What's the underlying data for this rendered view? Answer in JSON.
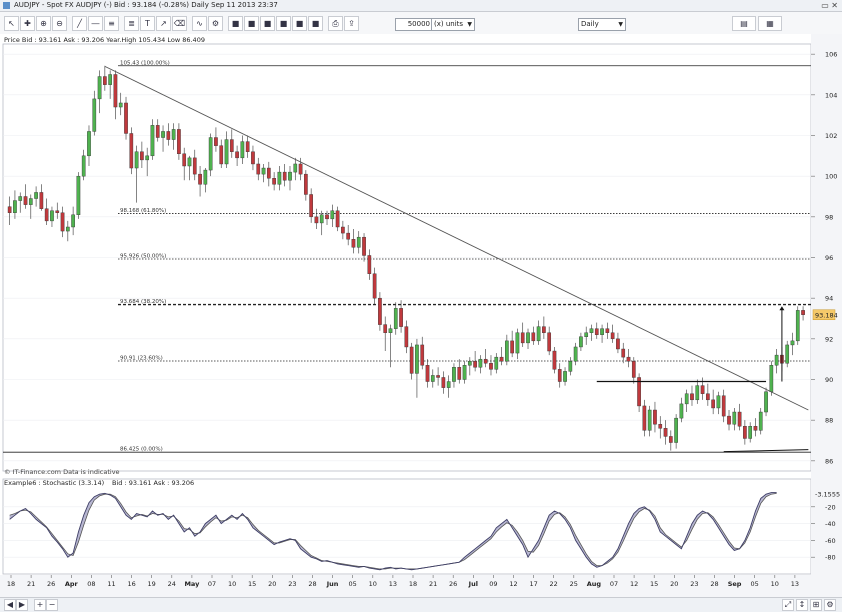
{
  "window": {
    "title": "AUDJPY - Spot FX AUDJPY (-)   Bid : 93.184 (-0.28%)   Daily   Sep 11 2013 23:37"
  },
  "toolbar": {
    "units_value": "50000",
    "units_label": "(x) units",
    "period_label": "Daily"
  },
  "price_panel": {
    "header": "Price   Bid : 93.161 Ask : 93.206  Year.High 105.434 Low 86.409",
    "last_price_label": "93.184",
    "y_ticks": [
      "106",
      "104",
      "102",
      "100",
      "98",
      "96",
      "94",
      "92",
      "90",
      "88",
      "86"
    ],
    "watermark": "© IT-Finance.com  Data is indicative"
  },
  "stoch_panel": {
    "header": "Example6 : Stochastic (3.3.14)",
    "overlay": "Bid : 93.161 Ask : 93.206",
    "value_label": "-3.1555",
    "y_ticks": [
      "-20",
      "-40",
      "-60",
      "-80"
    ]
  },
  "x_axis": {
    "ticks": [
      {
        "label": "18",
        "bold": false
      },
      {
        "label": "21",
        "bold": false
      },
      {
        "label": "26",
        "bold": false
      },
      {
        "label": "Apr",
        "bold": true
      },
      {
        "label": "08",
        "bold": false
      },
      {
        "label": "11",
        "bold": false
      },
      {
        "label": "16",
        "bold": false
      },
      {
        "label": "19",
        "bold": false
      },
      {
        "label": "24",
        "bold": false
      },
      {
        "label": "May",
        "bold": true
      },
      {
        "label": "07",
        "bold": false
      },
      {
        "label": "10",
        "bold": false
      },
      {
        "label": "15",
        "bold": false
      },
      {
        "label": "20",
        "bold": false
      },
      {
        "label": "23",
        "bold": false
      },
      {
        "label": "28",
        "bold": false
      },
      {
        "label": "Jun",
        "bold": true
      },
      {
        "label": "05",
        "bold": false
      },
      {
        "label": "10",
        "bold": false
      },
      {
        "label": "13",
        "bold": false
      },
      {
        "label": "18",
        "bold": false
      },
      {
        "label": "21",
        "bold": false
      },
      {
        "label": "26",
        "bold": false
      },
      {
        "label": "Jul",
        "bold": true
      },
      {
        "label": "09",
        "bold": false
      },
      {
        "label": "12",
        "bold": false
      },
      {
        "label": "17",
        "bold": false
      },
      {
        "label": "22",
        "bold": false
      },
      {
        "label": "25",
        "bold": false
      },
      {
        "label": "Aug",
        "bold": true
      },
      {
        "label": "07",
        "bold": false
      },
      {
        "label": "12",
        "bold": false
      },
      {
        "label": "15",
        "bold": false
      },
      {
        "label": "20",
        "bold": false
      },
      {
        "label": "23",
        "bold": false
      },
      {
        "label": "28",
        "bold": false
      },
      {
        "label": "Sep",
        "bold": true
      },
      {
        "label": "05",
        "bold": false
      },
      {
        "label": "10",
        "bold": false
      },
      {
        "label": "13",
        "bold": false
      }
    ]
  },
  "chart_data": {
    "type": "candlestick",
    "ylim": [
      85.5,
      106.5
    ],
    "stoch_ylim": [
      -100,
      0
    ],
    "fib_levels": [
      {
        "label": "105.43 (100.00%)",
        "value": 105.43,
        "style": "solid"
      },
      {
        "label": "98.168 (61.80%)",
        "value": 98.168,
        "style": "dotted"
      },
      {
        "label": "95.926 (50.00%)",
        "value": 95.926,
        "style": "dotted"
      },
      {
        "label": "93.684 (38.20%)",
        "value": 93.684,
        "style": "dashed"
      },
      {
        "label": "90.91 (23.60%)",
        "value": 90.91,
        "style": "dotted"
      },
      {
        "label": "86.425 (0.00%)",
        "value": 86.425,
        "style": "solid"
      }
    ],
    "ohlc": [
      [
        98.5,
        99.0,
        97.6,
        98.2
      ],
      [
        98.2,
        99.3,
        97.9,
        98.8
      ],
      [
        98.8,
        99.2,
        98.2,
        99.0
      ],
      [
        99.0,
        99.6,
        98.4,
        98.6
      ],
      [
        98.6,
        99.1,
        97.9,
        98.9
      ],
      [
        98.9,
        99.5,
        98.5,
        99.2
      ],
      [
        99.2,
        99.6,
        98.3,
        98.4
      ],
      [
        98.4,
        98.9,
        97.6,
        97.8
      ],
      [
        97.8,
        98.5,
        97.5,
        98.3
      ],
      [
        98.3,
        98.7,
        97.9,
        98.2
      ],
      [
        98.2,
        98.5,
        97.0,
        97.3
      ],
      [
        97.3,
        97.8,
        96.8,
        97.5
      ],
      [
        97.5,
        98.5,
        97.1,
        98.1
      ],
      [
        98.1,
        100.2,
        97.9,
        100.0
      ],
      [
        100.0,
        101.3,
        99.8,
        101.0
      ],
      [
        101.0,
        102.5,
        100.5,
        102.2
      ],
      [
        102.2,
        104.2,
        102.0,
        103.8
      ],
      [
        103.8,
        105.2,
        103.1,
        104.9
      ],
      [
        104.9,
        105.43,
        104.2,
        104.5
      ],
      [
        104.5,
        105.2,
        103.8,
        105.0
      ],
      [
        105.0,
        105.2,
        102.8,
        103.4
      ],
      [
        103.4,
        104.1,
        103.0,
        103.6
      ],
      [
        103.6,
        103.9,
        101.8,
        102.1
      ],
      [
        102.1,
        102.4,
        100.1,
        100.4
      ],
      [
        100.4,
        101.5,
        98.7,
        101.2
      ],
      [
        101.2,
        101.7,
        100.4,
        100.8
      ],
      [
        100.8,
        101.4,
        100.0,
        101.0
      ],
      [
        101.0,
        102.8,
        100.8,
        102.5
      ],
      [
        102.5,
        102.8,
        101.7,
        101.9
      ],
      [
        101.9,
        102.5,
        101.2,
        102.2
      ],
      [
        102.2,
        102.6,
        101.5,
        101.8
      ],
      [
        101.8,
        102.6,
        101.3,
        102.3
      ],
      [
        102.3,
        102.6,
        100.8,
        101.1
      ],
      [
        101.1,
        101.4,
        99.8,
        100.5
      ],
      [
        100.5,
        101.0,
        99.8,
        100.9
      ],
      [
        100.9,
        101.3,
        99.8,
        100.1
      ],
      [
        100.1,
        100.5,
        99.0,
        99.6
      ],
      [
        99.6,
        100.4,
        99.2,
        100.3
      ],
      [
        100.3,
        102.1,
        100.0,
        101.9
      ],
      [
        101.9,
        102.4,
        101.2,
        101.5
      ],
      [
        101.5,
        101.8,
        100.4,
        100.6
      ],
      [
        100.6,
        102.2,
        100.4,
        101.8
      ],
      [
        101.8,
        102.3,
        100.9,
        101.2
      ],
      [
        101.2,
        101.5,
        100.5,
        100.9
      ],
      [
        100.9,
        102.0,
        100.6,
        101.7
      ],
      [
        101.7,
        102.0,
        100.9,
        101.2
      ],
      [
        101.2,
        101.5,
        100.3,
        100.6
      ],
      [
        100.6,
        100.9,
        99.8,
        100.1
      ],
      [
        100.1,
        100.6,
        99.7,
        100.4
      ],
      [
        100.4,
        100.7,
        99.5,
        99.9
      ],
      [
        99.9,
        100.2,
        99.3,
        99.6
      ],
      [
        99.6,
        100.5,
        99.3,
        100.2
      ],
      [
        100.2,
        100.6,
        99.5,
        99.8
      ],
      [
        99.8,
        100.5,
        99.3,
        100.2
      ],
      [
        100.2,
        100.9,
        99.8,
        100.6
      ],
      [
        100.6,
        100.9,
        99.8,
        100.1
      ],
      [
        100.1,
        100.3,
        98.8,
        99.1
      ],
      [
        99.1,
        99.4,
        97.7,
        98.0
      ],
      [
        98.0,
        98.4,
        97.4,
        97.7
      ],
      [
        97.7,
        98.3,
        97.1,
        98.1
      ],
      [
        98.1,
        98.3,
        97.6,
        97.9
      ],
      [
        97.9,
        98.6,
        97.5,
        98.3
      ],
      [
        98.3,
        98.5,
        97.3,
        97.5
      ],
      [
        97.5,
        97.8,
        96.9,
        97.2
      ],
      [
        97.2,
        97.6,
        96.6,
        96.9
      ],
      [
        96.9,
        97.4,
        96.2,
        96.5
      ],
      [
        96.5,
        97.3,
        96.2,
        97.0
      ],
      [
        97.0,
        97.2,
        95.8,
        96.1
      ],
      [
        96.1,
        96.4,
        94.9,
        95.2
      ],
      [
        95.2,
        95.5,
        93.7,
        94.0
      ],
      [
        94.0,
        94.3,
        92.4,
        92.7
      ],
      [
        92.7,
        93.1,
        91.4,
        92.3
      ],
      [
        92.3,
        92.7,
        90.6,
        92.5
      ],
      [
        92.5,
        93.8,
        92.2,
        93.5
      ],
      [
        93.5,
        93.9,
        92.3,
        92.6
      ],
      [
        92.6,
        92.9,
        91.3,
        91.6
      ],
      [
        91.6,
        91.8,
        90.0,
        90.3
      ],
      [
        90.3,
        92.0,
        89.1,
        91.7
      ],
      [
        91.7,
        92.1,
        90.5,
        90.7
      ],
      [
        90.7,
        91.0,
        89.6,
        89.9
      ],
      [
        89.9,
        90.5,
        89.6,
        90.2
      ],
      [
        90.2,
        90.6,
        89.7,
        90.1
      ],
      [
        90.1,
        90.4,
        89.3,
        89.6
      ],
      [
        89.6,
        90.2,
        89.1,
        89.9
      ],
      [
        89.9,
        90.8,
        89.6,
        90.6
      ],
      [
        90.6,
        91.0,
        89.8,
        90.0
      ],
      [
        90.0,
        90.9,
        89.8,
        90.7
      ],
      [
        90.7,
        91.1,
        90.2,
        90.9
      ],
      [
        90.9,
        91.4,
        90.4,
        90.6
      ],
      [
        90.6,
        91.2,
        90.3,
        91.0
      ],
      [
        91.0,
        91.5,
        90.6,
        90.8
      ],
      [
        90.8,
        91.2,
        90.2,
        90.5
      ],
      [
        90.5,
        91.3,
        90.3,
        91.1
      ],
      [
        91.1,
        91.6,
        90.7,
        90.9
      ],
      [
        90.9,
        92.2,
        90.7,
        91.9
      ],
      [
        91.9,
        92.4,
        91.1,
        91.3
      ],
      [
        91.3,
        92.5,
        91.0,
        92.3
      ],
      [
        92.3,
        92.8,
        91.6,
        91.8
      ],
      [
        91.8,
        92.5,
        91.5,
        92.3
      ],
      [
        92.3,
        92.6,
        91.7,
        91.9
      ],
      [
        91.9,
        92.9,
        91.7,
        92.6
      ],
      [
        92.6,
        93.1,
        92.0,
        92.3
      ],
      [
        92.3,
        92.6,
        91.2,
        91.4
      ],
      [
        91.4,
        91.6,
        90.3,
        90.5
      ],
      [
        90.5,
        90.8,
        89.6,
        89.9
      ],
      [
        89.9,
        90.6,
        89.7,
        90.4
      ],
      [
        90.4,
        91.1,
        90.2,
        90.9
      ],
      [
        90.9,
        91.8,
        90.7,
        91.6
      ],
      [
        91.6,
        92.3,
        91.4,
        92.1
      ],
      [
        92.1,
        92.6,
        91.7,
        92.3
      ],
      [
        92.3,
        92.7,
        91.9,
        92.5
      ],
      [
        92.5,
        92.8,
        92.0,
        92.2
      ],
      [
        92.2,
        92.7,
        91.8,
        92.5
      ],
      [
        92.5,
        92.8,
        92.0,
        92.3
      ],
      [
        92.3,
        92.7,
        91.8,
        92.0
      ],
      [
        92.0,
        92.3,
        91.3,
        91.5
      ],
      [
        91.5,
        91.8,
        90.8,
        91.1
      ],
      [
        91.1,
        91.5,
        90.6,
        90.9
      ],
      [
        90.9,
        91.1,
        89.8,
        90.1
      ],
      [
        90.1,
        90.3,
        88.4,
        88.7
      ],
      [
        88.7,
        89.0,
        87.2,
        87.5
      ],
      [
        87.5,
        88.7,
        87.2,
        88.5
      ],
      [
        88.5,
        88.9,
        87.4,
        87.8
      ],
      [
        87.8,
        88.2,
        87.1,
        87.6
      ],
      [
        87.6,
        88.0,
        86.8,
        87.2
      ],
      [
        87.2,
        87.5,
        86.5,
        86.9
      ],
      [
        86.9,
        88.3,
        86.6,
        88.1
      ],
      [
        88.1,
        89.1,
        87.9,
        88.8
      ],
      [
        88.8,
        89.5,
        88.4,
        89.3
      ],
      [
        89.3,
        89.7,
        88.7,
        89.0
      ],
      [
        89.0,
        90.0,
        88.8,
        89.7
      ],
      [
        89.7,
        90.1,
        89.0,
        89.3
      ],
      [
        89.3,
        89.8,
        88.7,
        89.0
      ],
      [
        89.0,
        89.5,
        88.3,
        88.6
      ],
      [
        88.6,
        89.4,
        88.3,
        89.2
      ],
      [
        89.2,
        89.5,
        87.9,
        88.2
      ],
      [
        88.2,
        88.5,
        87.5,
        87.8
      ],
      [
        87.8,
        88.6,
        87.5,
        88.4
      ],
      [
        88.4,
        88.8,
        87.5,
        87.7
      ],
      [
        87.7,
        88.0,
        86.8,
        87.1
      ],
      [
        87.1,
        87.9,
        86.9,
        87.7
      ],
      [
        87.7,
        88.1,
        87.2,
        87.5
      ],
      [
        87.5,
        88.6,
        87.3,
        88.4
      ],
      [
        88.4,
        89.6,
        88.2,
        89.4
      ],
      [
        89.4,
        90.9,
        89.2,
        90.7
      ],
      [
        90.7,
        91.5,
        90.3,
        91.2
      ],
      [
        91.2,
        91.6,
        90.4,
        90.8
      ],
      [
        90.8,
        91.9,
        90.6,
        91.7
      ],
      [
        91.7,
        92.3,
        91.2,
        91.9
      ],
      [
        91.9,
        93.6,
        91.7,
        93.4
      ],
      [
        93.4,
        93.6,
        92.9,
        93.184
      ]
    ],
    "stochastic": [
      -35,
      -30,
      -25,
      -22,
      -28,
      -35,
      -40,
      -45,
      -55,
      -62,
      -70,
      -80,
      -75,
      -50,
      -30,
      -15,
      -8,
      -5,
      -4,
      -6,
      -10,
      -20,
      -30,
      -35,
      -28,
      -30,
      -32,
      -25,
      -30,
      -28,
      -35,
      -30,
      -40,
      -50,
      -45,
      -55,
      -50,
      -40,
      -35,
      -30,
      -40,
      -35,
      -30,
      -35,
      -28,
      -35,
      -45,
      -50,
      -55,
      -60,
      -65,
      -62,
      -60,
      -58,
      -60,
      -70,
      -75,
      -80,
      -82,
      -85,
      -84,
      -86,
      -88,
      -89,
      -90,
      -91,
      -92,
      -91,
      -93,
      -94,
      -95,
      -93,
      -92,
      -94,
      -93,
      -94,
      -95,
      -94,
      -93,
      -92,
      -91,
      -90,
      -89,
      -88,
      -87,
      -86,
      -80,
      -75,
      -70,
      -65,
      -60,
      -55,
      -45,
      -40,
      -35,
      -45,
      -55,
      -65,
      -80,
      -70,
      -60,
      -45,
      -30,
      -25,
      -28,
      -35,
      -45,
      -60,
      -70,
      -80,
      -88,
      -92,
      -90,
      -85,
      -80,
      -70,
      -55,
      -40,
      -28,
      -22,
      -20,
      -25,
      -35,
      -50,
      -55,
      -60,
      -65,
      -70,
      -55,
      -40,
      -30,
      -25,
      -28,
      -35,
      -45,
      -55,
      -65,
      -72,
      -70,
      -60,
      -45,
      -25,
      -10,
      -5,
      -3,
      -3
    ],
    "stoch_signal": [
      -30,
      -28,
      -25,
      -24,
      -26,
      -32,
      -38,
      -44,
      -52,
      -60,
      -68,
      -76,
      -78,
      -62,
      -42,
      -24,
      -12,
      -7,
      -5,
      -5,
      -8,
      -16,
      -26,
      -33,
      -31,
      -29,
      -31,
      -28,
      -29,
      -29,
      -32,
      -31,
      -37,
      -46,
      -47,
      -52,
      -51,
      -44,
      -38,
      -33,
      -37,
      -36,
      -32,
      -33,
      -30,
      -33,
      -41,
      -48,
      -53,
      -58,
      -63,
      -63,
      -61,
      -59,
      -59,
      -66,
      -72,
      -78,
      -81,
      -84,
      -85,
      -86,
      -87,
      -88,
      -89,
      -90,
      -91,
      -91,
      -92,
      -93,
      -94,
      -94,
      -93,
      -93,
      -93,
      -94,
      -94,
      -94,
      -93,
      -92,
      -91,
      -90,
      -89,
      -88,
      -87,
      -86,
      -83,
      -78,
      -73,
      -68,
      -63,
      -58,
      -50,
      -44,
      -39,
      -42,
      -50,
      -60,
      -73,
      -74,
      -66,
      -52,
      -37,
      -29,
      -27,
      -32,
      -41,
      -54,
      -65,
      -76,
      -85,
      -90,
      -90,
      -87,
      -82,
      -74,
      -61,
      -47,
      -34,
      -26,
      -22,
      -24,
      -31,
      -45,
      -53,
      -58,
      -63,
      -68,
      -60,
      -47,
      -35,
      -28,
      -27,
      -32,
      -41,
      -51,
      -61,
      -69,
      -70,
      -63,
      -50,
      -32,
      -16,
      -8,
      -5,
      -4
    ],
    "trendline": {
      "from": [
        18,
        105.4
      ],
      "to": [
        151,
        88.5
      ]
    },
    "support_line": {
      "from_index": 111,
      "to_index": 143,
      "value": 89.9
    },
    "bottom_line": {
      "from": [
        135,
        86.45
      ],
      "to": [
        151,
        86.55
      ]
    },
    "current_price_arrow": {
      "index": 146,
      "from": 89.9,
      "to": 93.6
    }
  },
  "colors": {
    "up_candle": "#4fb24f",
    "down_candle": "#c0393d",
    "stoch_fill": "#aaa9c9",
    "stoch_line": "#3e3e66",
    "panel_bg": "#ffffff",
    "grid": "#eceef2",
    "axis_bg": "#f4f5f8",
    "price_tag": "#f5c96a"
  },
  "icons": [
    "cursor-icon",
    "crosshair-icon",
    "zoom-icon",
    "line-tool-icon",
    "text-tool-icon",
    "fib-tool-icon",
    "print-icon",
    "settings-icon",
    "close-icon"
  ]
}
